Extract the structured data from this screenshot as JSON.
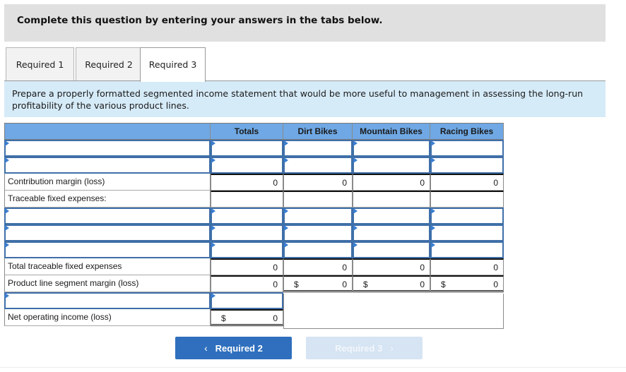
{
  "banner": {
    "text": "Complete this question by entering your answers in the tabs below."
  },
  "tabs": [
    {
      "label": "Required 1",
      "active": false
    },
    {
      "label": "Required 2",
      "active": false
    },
    {
      "label": "Required 3",
      "active": true
    }
  ],
  "instruction": "Prepare a properly formatted segmented income statement that would be more useful to management in assessing the long-run profitability of the various product lines.",
  "table": {
    "headers": [
      "",
      "Totals",
      "Dirt Bikes",
      "Mountain Bikes",
      "Racing Bikes"
    ],
    "rows": {
      "contribution_margin": {
        "label": "Contribution margin (loss)",
        "values": [
          "0",
          "0",
          "0",
          "0"
        ]
      },
      "traceable_fixed": {
        "label": "Traceable fixed expenses:"
      },
      "total_traceable": {
        "label": "Total traceable fixed expenses",
        "values": [
          "0",
          "0",
          "0",
          "0"
        ]
      },
      "segment_margin": {
        "label": "Product line segment margin (loss)",
        "currency": "$",
        "values": [
          "0",
          "0",
          "0",
          "0"
        ]
      },
      "net_operating_income": {
        "label": "Net operating income (loss)",
        "currency": "$",
        "value": "0"
      }
    },
    "input_placeholder": ""
  },
  "nav": {
    "prev_label": "Required 2",
    "prev_icon": "chevron-left-icon",
    "next_label": "Required 3",
    "next_icon": "chevron-right-icon",
    "next_disabled": true
  },
  "colors": {
    "header_blue": "#6fa8e4",
    "instruction_bg": "#d6ebf8",
    "input_border": "#3f6fa8",
    "prev_button": "#2f6fbd",
    "next_button_disabled": "#d6e4f3"
  }
}
